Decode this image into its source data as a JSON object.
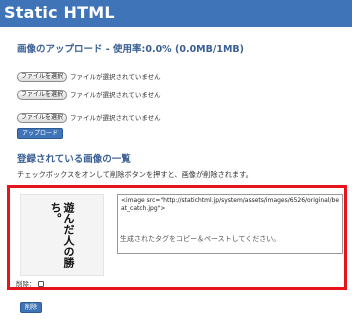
{
  "header": {
    "title": "Static HTML"
  },
  "upload": {
    "title": "画像のアップロード - 使用率:0.0% (0.0MB/1MB)",
    "rows": [
      {
        "button_label": "ファイルを選択",
        "status": "ファイルが選択されていません"
      },
      {
        "button_label": "ファイルを選択",
        "status": "ファイルが選択されていません"
      },
      {
        "button_label": "ファイルを選択",
        "status": "ファイルが選択されていません"
      }
    ],
    "submit_label": "アップロード"
  },
  "list": {
    "title": "登録されている画像の一覧",
    "instruction": "チェックボックスをオンして削除ボタンを押すと、画像が削除されます。",
    "items": [
      {
        "thumbnail_text": "遊んだ人の勝ち。",
        "tag": "<image src=\"http://statichtml.jp/system/assets/images/6526/original/beat_catch.jpg\">",
        "copy_hint": "生成されたタグをコピー＆ペーストしてください。",
        "delete_label": "削除：",
        "delete_checked": false
      }
    ],
    "delete_button_label": "削除"
  },
  "colors": {
    "accent": "#3f74b8",
    "title_text": "#3a5f94",
    "highlight": "#e8141c"
  }
}
